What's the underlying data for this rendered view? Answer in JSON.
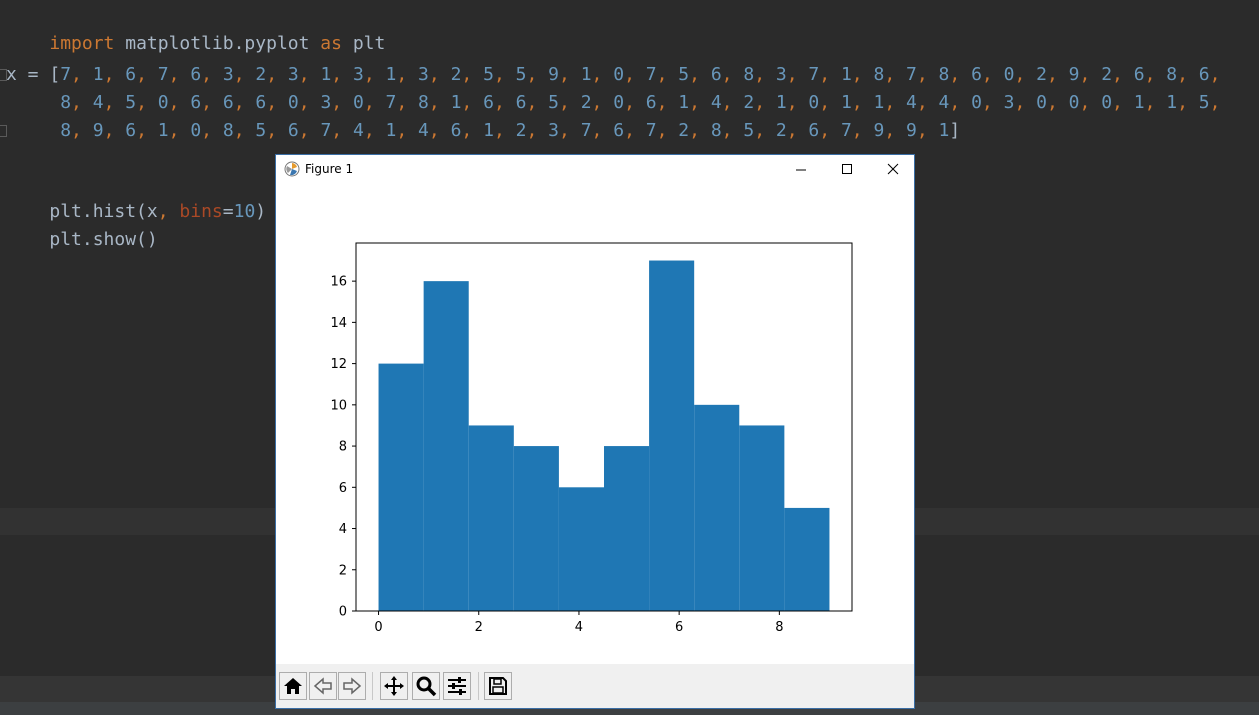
{
  "editor": {
    "line1": {
      "kw_import": "import",
      "module": " matplotlib.pyplot ",
      "kw_as": "as",
      "alias": " plt"
    },
    "x_assign": "x = [",
    "x_values": [
      7,
      1,
      6,
      7,
      6,
      3,
      2,
      3,
      1,
      3,
      1,
      3,
      2,
      5,
      5,
      9,
      1,
      0,
      7,
      5,
      6,
      8,
      3,
      7,
      1,
      8,
      7,
      8,
      6,
      0,
      2,
      9,
      2,
      6,
      8,
      6,
      8,
      4,
      5,
      0,
      6,
      6,
      6,
      0,
      3,
      0,
      7,
      8,
      1,
      6,
      6,
      5,
      2,
      0,
      6,
      1,
      4,
      2,
      1,
      0,
      1,
      1,
      4,
      4,
      0,
      3,
      0,
      0,
      0,
      1,
      1,
      5,
      8,
      9,
      6,
      1,
      0,
      8,
      5,
      6,
      7,
      4,
      1,
      4,
      6,
      1,
      2,
      3,
      7,
      6,
      7,
      2,
      8,
      5,
      2,
      6,
      7,
      9,
      9,
      1
    ],
    "x_close": "]",
    "hist_call": {
      "prefix": "plt.hist(x",
      "comma": ",",
      "param": " bins",
      "eq": "=",
      "value": "10",
      "suffix": ")"
    },
    "show_call": "plt.show()"
  },
  "figure": {
    "title": "Figure 1",
    "toolbar": [
      "home-icon",
      "back-icon",
      "forward-icon",
      "pan-icon",
      "zoom-icon",
      "configure-icon",
      "save-icon"
    ]
  },
  "colors": {
    "bar": "#1f77b4",
    "editor_bg": "#2b2b2b",
    "keyword": "#cc7832",
    "number": "#6897bb",
    "text": "#a9b7c6"
  },
  "chart_data": {
    "type": "bar",
    "bin_edges": [
      0,
      0.9,
      1.8,
      2.7,
      3.6,
      4.5,
      5.4,
      6.3,
      7.2,
      8.1,
      9.0
    ],
    "counts": [
      12,
      16,
      9,
      8,
      6,
      8,
      17,
      10,
      9,
      5
    ],
    "xticks": [
      0,
      2,
      4,
      6,
      8
    ],
    "yticks": [
      0,
      2,
      4,
      6,
      8,
      10,
      12,
      14,
      16
    ],
    "xlim": [
      -0.45,
      9.45
    ],
    "ylim": [
      0,
      17.85
    ],
    "title": "",
    "xlabel": "",
    "ylabel": ""
  }
}
